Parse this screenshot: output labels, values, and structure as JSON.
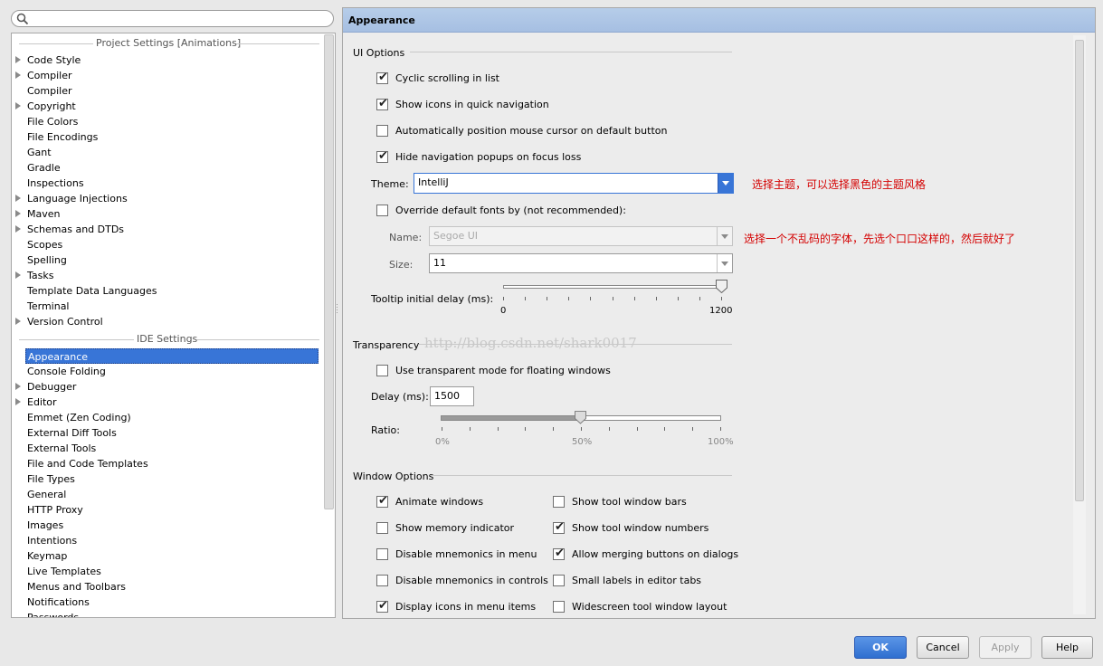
{
  "search": {
    "placeholder": ""
  },
  "tree": {
    "project_group_title": "Project Settings [Animations]",
    "project_items": [
      {
        "label": "Code Style",
        "expandable": true
      },
      {
        "label": "Compiler",
        "expandable": true
      },
      {
        "label": "Compiler",
        "expandable": false
      },
      {
        "label": "Copyright",
        "expandable": true
      },
      {
        "label": "File Colors",
        "expandable": false
      },
      {
        "label": "File Encodings",
        "expandable": false
      },
      {
        "label": "Gant",
        "expandable": false
      },
      {
        "label": "Gradle",
        "expandable": false
      },
      {
        "label": "Inspections",
        "expandable": false
      },
      {
        "label": "Language Injections",
        "expandable": true
      },
      {
        "label": "Maven",
        "expandable": true
      },
      {
        "label": "Schemas and DTDs",
        "expandable": true
      },
      {
        "label": "Scopes",
        "expandable": false
      },
      {
        "label": "Spelling",
        "expandable": false
      },
      {
        "label": "Tasks",
        "expandable": true
      },
      {
        "label": "Template Data Languages",
        "expandable": false
      },
      {
        "label": "Terminal",
        "expandable": false
      },
      {
        "label": "Version Control",
        "expandable": true
      }
    ],
    "ide_group_title": "IDE Settings",
    "ide_items": [
      {
        "label": "Appearance",
        "expandable": false,
        "selected": true
      },
      {
        "label": "Console Folding",
        "expandable": false
      },
      {
        "label": "Debugger",
        "expandable": true
      },
      {
        "label": "Editor",
        "expandable": true
      },
      {
        "label": "Emmet (Zen Coding)",
        "expandable": false
      },
      {
        "label": "External Diff Tools",
        "expandable": false
      },
      {
        "label": "External Tools",
        "expandable": false
      },
      {
        "label": "File and Code Templates",
        "expandable": false
      },
      {
        "label": "File Types",
        "expandable": false
      },
      {
        "label": "General",
        "expandable": false
      },
      {
        "label": "HTTP Proxy",
        "expandable": false
      },
      {
        "label": "Images",
        "expandable": false
      },
      {
        "label": "Intentions",
        "expandable": false
      },
      {
        "label": "Keymap",
        "expandable": false
      },
      {
        "label": "Live Templates",
        "expandable": false
      },
      {
        "label": "Menus and Toolbars",
        "expandable": false
      },
      {
        "label": "Notifications",
        "expandable": false
      },
      {
        "label": "Passwords",
        "expandable": false
      }
    ]
  },
  "panel": {
    "title": "Appearance",
    "ui_options": {
      "title": "UI Options",
      "cyclic_scrolling": {
        "label": "Cyclic scrolling in list",
        "checked": true
      },
      "show_icons": {
        "label": "Show icons in quick navigation",
        "checked": true
      },
      "auto_position_mouse": {
        "label": "Automatically position mouse cursor on default button",
        "checked": false
      },
      "hide_nav_popups": {
        "label": "Hide navigation popups on focus loss",
        "checked": true
      },
      "theme_label": "Theme:",
      "theme_value": "IntelliJ",
      "theme_note": "选择主题，可以选择黑色的主题风格",
      "override_fonts": {
        "label": "Override default fonts by (not recommended):",
        "checked": false
      },
      "name_label": "Name:",
      "name_value": "Segoe UI",
      "font_note": "选择一个不乱码的字体，先选个口口这样的，然后就好了",
      "size_label": "Size:",
      "size_value": "11",
      "tooltip_label": "Tooltip initial delay (ms):",
      "tooltip_min": "0",
      "tooltip_max": "1200",
      "tooltip_value": 1200
    },
    "transparency": {
      "title": "Transparency",
      "watermark": "http://blog.csdn.net/shark0017",
      "use_transparent": {
        "label": "Use transparent mode for floating windows",
        "checked": false
      },
      "delay_label": "Delay (ms):",
      "delay_value": "1500",
      "ratio_label": "Ratio:",
      "ratio_ticks": [
        "0%",
        "50%",
        "100%"
      ],
      "ratio_value": 0.5
    },
    "window_options": {
      "title": "Window Options",
      "left": [
        {
          "label": "Animate windows",
          "checked": true
        },
        {
          "label": "Show memory indicator",
          "checked": false
        },
        {
          "label": "Disable mnemonics in menu",
          "checked": false
        },
        {
          "label": "Disable mnemonics in controls",
          "checked": false
        },
        {
          "label": "Display icons in menu items",
          "checked": true
        }
      ],
      "right": [
        {
          "label": "Show tool window bars",
          "checked": false
        },
        {
          "label": "Show tool window numbers",
          "checked": true
        },
        {
          "label": "Allow merging buttons on dialogs",
          "checked": true
        },
        {
          "label": "Small labels in editor tabs",
          "checked": false
        },
        {
          "label": "Widescreen tool window layout",
          "checked": false
        }
      ]
    }
  },
  "buttons": {
    "ok": "OK",
    "cancel": "Cancel",
    "apply": "Apply",
    "help": "Help"
  },
  "colors": {
    "selection": "#3875d7",
    "header": "#a6bfe2",
    "note": "#d40000"
  }
}
